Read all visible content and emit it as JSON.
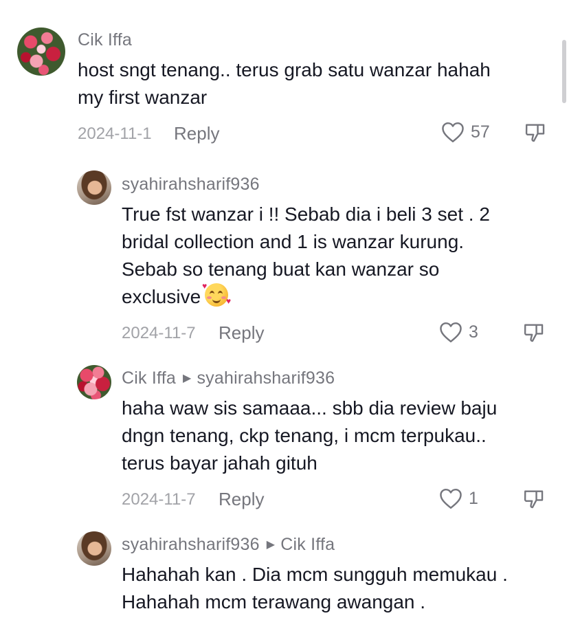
{
  "comments": [
    {
      "username": "Cik Iffa",
      "reply_to": "",
      "lines": [
        "host sngt tenang.. terus grab satu wanzar hahah",
        "my first wanzar"
      ],
      "date": "2024-11-1",
      "reply_label": "Reply",
      "likes": "57",
      "avatar": "flowers"
    },
    {
      "username": "syahirahsharif936",
      "reply_to": "",
      "lines": [
        "True fst wanzar i !! Sebab dia i beli 3 set . 2",
        "bridal collection and 1 is wanzar kurung.",
        "Sebab so tenang buat kan wanzar so",
        "exclusive"
      ],
      "emoji": "smiling-face-with-hearts",
      "date": "2024-11-7",
      "reply_label": "Reply",
      "likes": "3",
      "avatar": "person"
    },
    {
      "username": "Cik Iffa",
      "reply_to": "syahirahsharif936",
      "lines": [
        "haha waw sis samaaa... sbb dia review baju",
        "dngn tenang, ckp tenang, i mcm terpukau..",
        "terus bayar jahah gituh"
      ],
      "date": "2024-11-7",
      "reply_label": "Reply",
      "likes": "1",
      "avatar": "flowers"
    },
    {
      "username": "syahirahsharif936",
      "reply_to": "Cik Iffa",
      "lines": [
        "Hahahah kan . Dia mcm sungguh memukau .",
        "Hahahah mcm terawang awangan ."
      ],
      "avatar": "person"
    }
  ],
  "icons": {
    "like": "heart-outline-icon",
    "dislike": "thumbs-down-icon",
    "reply_arrow": "triangle-right-icon"
  },
  "colors": {
    "text": "#161823",
    "muted": "#75767d",
    "date": "#a1a2a7"
  }
}
